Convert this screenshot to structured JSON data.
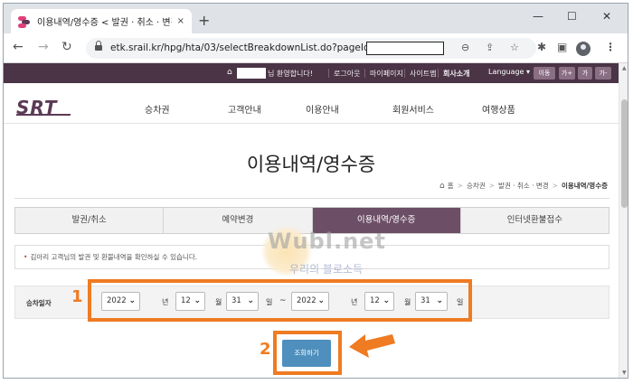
{
  "browser": {
    "tab_title": "이용내역/영수증 < 발권 · 취소 · 변경",
    "tab_close": "×",
    "new_tab": "+",
    "window_controls": {
      "minimize": "—",
      "maximize": "☐",
      "close": "✕"
    },
    "nav": {
      "back": "←",
      "forward": "→",
      "reload": "↻"
    },
    "url": "etk.srail.kr/hpg/hta/03/selectBreakdownList.do?pageId=",
    "omni_icons": {
      "zoom": "⊖",
      "share": "⇪",
      "bookmark": "☆"
    },
    "ext_icons": {
      "extensions": "✱",
      "side_panel": "▣",
      "menu": "⋮"
    }
  },
  "site": {
    "util": {
      "home_icon": "⌂",
      "greeting": "님 환영합니다!",
      "logout": "로그아웃",
      "mypage": "마이페이지",
      "sitemap": "사이트맵",
      "company": "회사소개",
      "language": "Language",
      "language_chevron": "▾",
      "go": "이동",
      "font_up": "가+",
      "font_normal": "가",
      "font_down": "가-"
    },
    "logo": "SRT",
    "gnb": [
      "승차권",
      "고객안내",
      "이용안내",
      "회원서비스",
      "여행상품"
    ],
    "page_title": "이용내역/영수증",
    "breadcrumb": {
      "home_icon": "⌂",
      "home": "홈",
      "sep": ">",
      "items": [
        "승차권",
        "발권 · 취소 · 변경",
        "이용내역/영수증"
      ]
    },
    "sub_tabs": [
      "발권/취소",
      "예약변경",
      "이용내역/영수증",
      "인터넷환불접수"
    ],
    "notice": {
      "bullet": "•",
      "text": "김아리 고객님의 발권 및 환불내역을 확인하실 수 있습니다."
    },
    "search": {
      "label": "승차일자",
      "from": {
        "year": "2022",
        "month": "12",
        "day": "31"
      },
      "to": {
        "year": "2022",
        "month": "12",
        "day": "31"
      },
      "units": {
        "year": "년",
        "month": "월",
        "day": "일"
      },
      "tilde": "~",
      "chevron": "⌄",
      "button": "조회하기"
    }
  },
  "annotations": {
    "callout_1": "1",
    "callout_2": "2",
    "color": "#ef7b22"
  },
  "watermark": {
    "text": "Wubl.net",
    "sub": "우리의 블로소득"
  }
}
